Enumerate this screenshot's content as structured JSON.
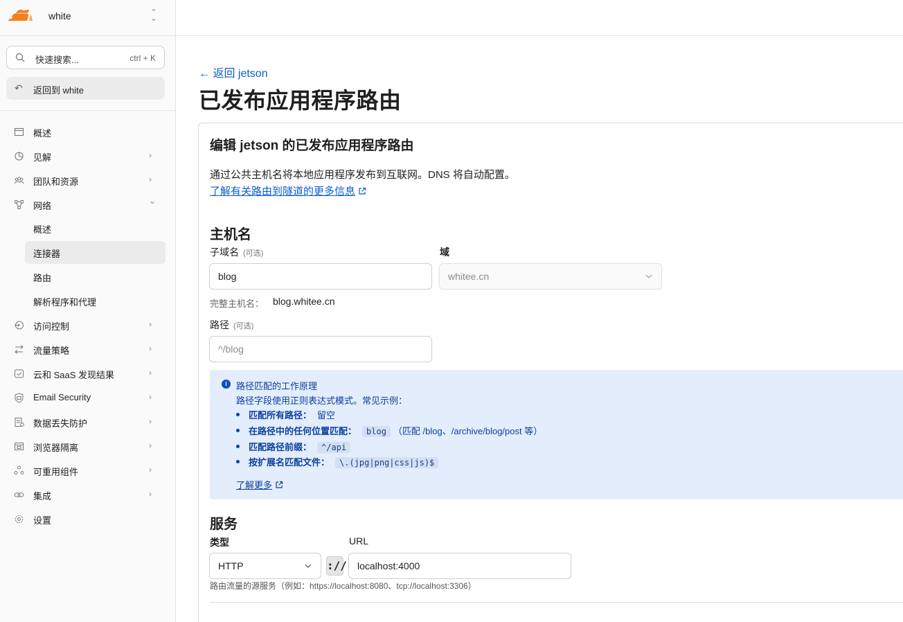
{
  "account": {
    "name": "white"
  },
  "search": {
    "placeholder": "快速搜索...",
    "shortcut": "ctrl + K"
  },
  "back_to_account": "返回到 white",
  "nav": [
    {
      "label": "概述",
      "icon": "window-icon",
      "arrow": ""
    },
    {
      "label": "见解",
      "icon": "pie-chart-icon",
      "arrow": "›"
    },
    {
      "label": "团队和资源",
      "icon": "people-icon",
      "arrow": "›"
    },
    {
      "label": "网络",
      "icon": "network-icon",
      "arrow": "⌄"
    },
    {
      "label": "访问控制",
      "icon": "login-icon",
      "arrow": "›"
    },
    {
      "label": "流量策略",
      "icon": "traffic-icon",
      "arrow": "›"
    },
    {
      "label": "云和 SaaS 发现结果",
      "icon": "cloud-check-icon",
      "arrow": "›"
    },
    {
      "label": "Email Security",
      "icon": "shield-icon",
      "arrow": "›"
    },
    {
      "label": "数据丢失防护",
      "icon": "data-icon",
      "arrow": "›"
    },
    {
      "label": "浏览器隔离",
      "icon": "browser-icon",
      "arrow": "›"
    },
    {
      "label": "可重用组件",
      "icon": "components-icon",
      "arrow": "›"
    },
    {
      "label": "集成",
      "icon": "link-icon",
      "arrow": "›"
    },
    {
      "label": "设置",
      "icon": "gear-icon",
      "arrow": ""
    }
  ],
  "network_sub": [
    "概述",
    "连接器",
    "路由",
    "解析程序和代理"
  ],
  "main": {
    "back_link": "← 返回 jetson",
    "title": "已发布应用程序路由",
    "card_title": "编辑 jetson 的已发布应用程序路由",
    "description": "通过公共主机名将本地应用程序发布到互联网。DNS 将自动配置。",
    "learn_more": "了解有关路由到隧道的更多信息"
  },
  "hostname": {
    "section": "主机名",
    "subdomain_label": "子域名",
    "optional": "(可选)",
    "subdomain_value": "blog",
    "domain_label": "域",
    "domain_value": "whitee.cn",
    "full_label": "完整主机名：",
    "full_value": "blog.whitee.cn",
    "path_label": "路径",
    "path_placeholder": "^/blog"
  },
  "info": {
    "title": "路径匹配的工作原理",
    "subtitle": "路径字段使用正则表达式模式。常见示例：",
    "bullets": [
      {
        "bold": "匹配所有路径：",
        "code": "",
        "text": "留空"
      },
      {
        "bold": "在路径中的任何位置匹配：",
        "code": "blog",
        "text": "（匹配 /blog、/archive/blog/post 等）"
      },
      {
        "bold": "匹配路径前缀：",
        "code": "^/api",
        "text": ""
      },
      {
        "bold": "按扩展名匹配文件：",
        "code": "\\.(jpg|png|css|js)$",
        "text": ""
      }
    ],
    "learn_more": "了解更多"
  },
  "service": {
    "section": "服务",
    "type_label": "类型",
    "type_value": "HTTP",
    "separator": "://",
    "url_label": "URL",
    "url_value": "localhost:4000",
    "hint": "路由流量的源服务（例如：https://localhost:8080、tcp://localhost:3306）"
  },
  "colors": {
    "link": "#0b5cd5",
    "info_bg": "#e3edfb",
    "brand_orange": "#f38020"
  }
}
